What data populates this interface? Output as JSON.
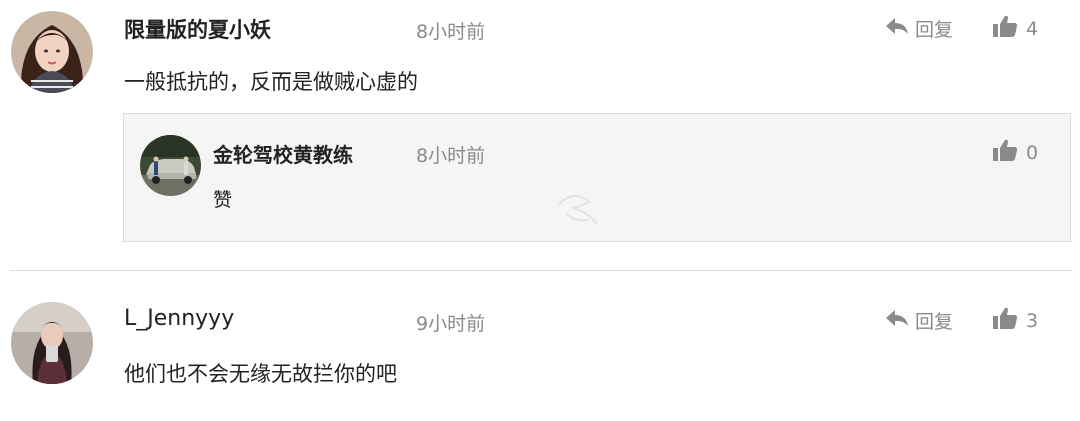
{
  "comments": [
    {
      "username": "限量版的夏小妖",
      "time": "8小时前",
      "content": "一般抵抗的，反而是做贼心虚的",
      "reply_label": "回复",
      "like_count": "4",
      "replies": [
        {
          "username": "金轮驾校黄教练",
          "time": "8小时前",
          "content": "赞",
          "like_count": "0"
        }
      ]
    },
    {
      "username": "L_Jennyyy",
      "time": "9小时前",
      "content": "他们也不会无缘无故拦你的吧",
      "reply_label": "回复",
      "like_count": "3"
    }
  ],
  "icons": {
    "reply": "reply-arrow-icon",
    "like": "thumbs-up-icon"
  },
  "colors": {
    "muted": "#8a8a8a",
    "text": "#222222",
    "reply_bg": "#f5f5f5"
  }
}
